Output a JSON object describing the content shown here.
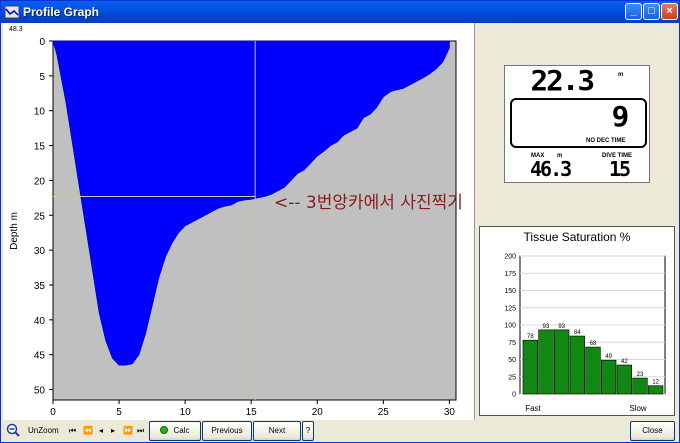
{
  "window": {
    "title": "Profile Graph"
  },
  "graph": {
    "max_depth_label": "48.3",
    "ylabel": "Depth m",
    "yticks": [
      "0",
      "5",
      "10",
      "15",
      "20",
      "25",
      "30",
      "35",
      "40",
      "45",
      "50"
    ],
    "xticks": [
      "0",
      "5",
      "10",
      "15",
      "20",
      "25",
      "30"
    ],
    "annotation": "<-- 3번앙카에서 사진찍기"
  },
  "chart_data": [
    {
      "type": "area",
      "title": "",
      "xlabel": "",
      "ylabel": "Depth m",
      "xlim": [
        0,
        30.5
      ],
      "ylim": [
        0,
        51.5
      ],
      "y_inverted": true,
      "x": [
        0,
        0.3,
        0.6,
        1,
        1.5,
        2,
        2.5,
        3,
        3.5,
        4,
        4.5,
        5,
        5.5,
        6,
        6.5,
        7,
        7.5,
        8,
        8.5,
        9,
        9.5,
        10,
        10.5,
        11,
        11.5,
        12,
        12.5,
        13,
        13.5,
        14,
        14.5,
        15,
        15.5,
        16,
        16.5,
        17,
        17.5,
        18,
        18.5,
        19,
        19.5,
        20,
        20.5,
        21,
        21.5,
        22,
        22.5,
        23,
        23.5,
        24,
        24.5,
        25,
        25.5,
        26,
        26.5,
        27,
        27.5,
        28,
        28.5,
        29,
        29.5,
        30
      ],
      "y": [
        0,
        2,
        5,
        9,
        15,
        21,
        27,
        33,
        39,
        43,
        45.5,
        46.5,
        46.5,
        46.3,
        45,
        42,
        38,
        34,
        31,
        29,
        27.5,
        26.5,
        26,
        25.5,
        25,
        24.5,
        24,
        23.7,
        23.5,
        23,
        22.8,
        22.7,
        22.5,
        22.3,
        22,
        21.5,
        21,
        20,
        19,
        18.5,
        17.5,
        16.5,
        15.8,
        15,
        14.5,
        13.5,
        13,
        12.5,
        11,
        10.5,
        9.5,
        8,
        7.3,
        7,
        6.8,
        6.3,
        5.8,
        5.3,
        4.7,
        4,
        3,
        1
      ]
    },
    {
      "type": "bar",
      "title": "Tissue Saturation %",
      "xlabel_left": "Fast",
      "xlabel_right": "Slow",
      "ylim": [
        0,
        200
      ],
      "yticks": [
        "0",
        "25",
        "50",
        "75",
        "100",
        "125",
        "150",
        "175",
        "200"
      ],
      "values": [
        78,
        93,
        93,
        84,
        68,
        49,
        42,
        23,
        12
      ]
    }
  ],
  "dive_computer": {
    "depth": "22.3",
    "depth_unit": "m",
    "ndl": "9",
    "ndl_label": "NO DEC TIME",
    "max_label": "MAX",
    "max_unit": "m",
    "max_depth": "46.3",
    "dive_time_label": "DIVE TIME",
    "dive_time": "15"
  },
  "toolbar": {
    "unzoom_label": "UnZoom",
    "calc_label": "Calc",
    "previous_label": "Previous",
    "next_label": "Next",
    "help_label": "?",
    "close_label": "Close"
  },
  "colors": {
    "profile_fill": "#0000ff",
    "plot_bg": "#c0c0c0",
    "bar_fill": "#118811",
    "annotation": "#8b1a1a",
    "title_bar": "#0449d8"
  }
}
